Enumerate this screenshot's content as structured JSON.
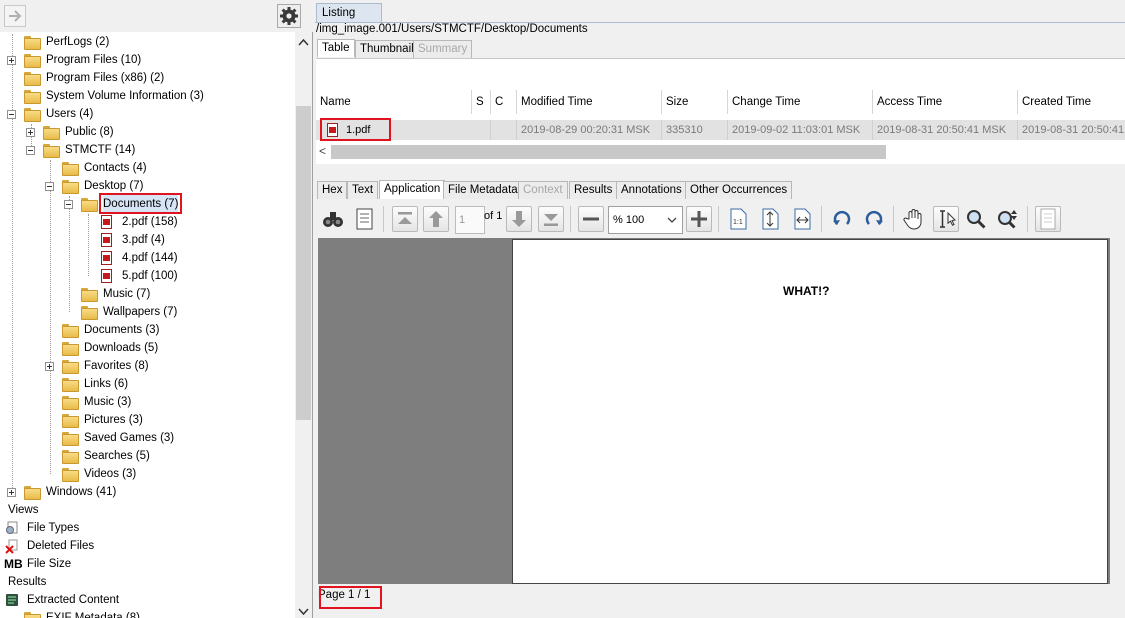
{
  "tree": {
    "rows": [
      {
        "label": "PerfLogs (2)"
      },
      {
        "label": "Program Files (10)"
      },
      {
        "label": "Program Files (x86) (2)"
      },
      {
        "label": "System Volume Information (3)"
      },
      {
        "label": "Users (4)"
      },
      {
        "label": "Public (8)"
      },
      {
        "label": "STMCTF (14)"
      },
      {
        "label": "Contacts (4)"
      },
      {
        "label": "Desktop (7)"
      },
      {
        "label": "Documents (7)"
      },
      {
        "label": "2.pdf (158)"
      },
      {
        "label": "3.pdf (4)"
      },
      {
        "label": "4.pdf (144)"
      },
      {
        "label": "5.pdf (100)"
      },
      {
        "label": "Music (7)"
      },
      {
        "label": "Wallpapers (7)"
      },
      {
        "label": "Documents (3)"
      },
      {
        "label": "Downloads (5)"
      },
      {
        "label": "Favorites (8)"
      },
      {
        "label": "Links (6)"
      },
      {
        "label": "Music (3)"
      },
      {
        "label": "Pictures (3)"
      },
      {
        "label": "Saved Games (3)"
      },
      {
        "label": "Searches (5)"
      },
      {
        "label": "Videos (3)"
      },
      {
        "label": "Windows (41)"
      }
    ],
    "views_header": "Views",
    "file_types": "File Types",
    "deleted_files": "Deleted Files",
    "mb_badge": "MB",
    "file_size": "File Size",
    "results_header": "Results",
    "extracted_content": "Extracted Content",
    "exif_metadata": "EXIF Metadata (8)"
  },
  "listing": {
    "tab_label": "Listing",
    "path": "/img_image.001/Users/STMCTF/Desktop/Documents",
    "view_tabs": [
      "Table",
      "Thumbnail",
      "Summary"
    ],
    "columns": [
      "Name",
      "S",
      "C",
      "Modified Time",
      "Size",
      "Change Time",
      "Access Time",
      "Created Time"
    ],
    "row": {
      "name": "1.pdf",
      "modified": "2019-08-29 00:20:31 MSK",
      "size": "335310",
      "changed": "2019-09-02 11:03:01 MSK",
      "accessed": "2019-08-31 20:50:41 MSK",
      "created": "2019-08-31 20:50:41"
    },
    "scroll_left_glyph": "<"
  },
  "viewer": {
    "tabs": [
      "Hex",
      "Text",
      "Application",
      "File Metadata",
      "Context",
      "Results",
      "Annotations",
      "Other Occurrences"
    ],
    "page_input": "1",
    "page_of": "of 1",
    "zoom": "% 100",
    "pdf_text": "WHAT!?",
    "status": "Page 1 / 1"
  },
  "colors": {
    "highlight": "#e0141e",
    "folder": "#f8dc87",
    "pdf_red": "#c41a1a"
  }
}
